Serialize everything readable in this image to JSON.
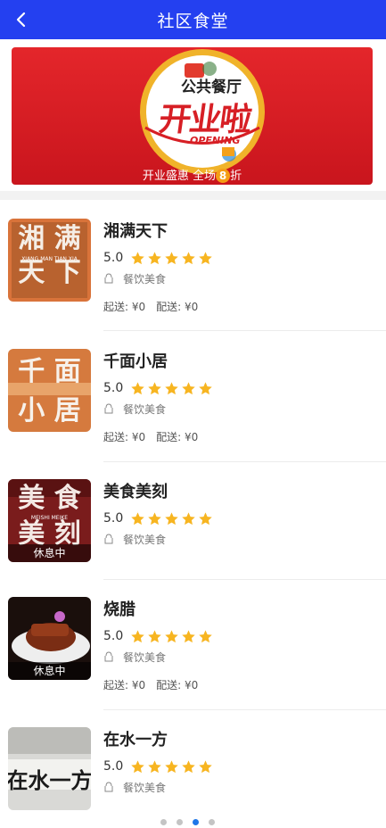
{
  "header": {
    "title": "社区食堂",
    "back_icon": "chevron-left-icon"
  },
  "banner": {
    "logo_text": "公共餐厅",
    "headline": "开业啦",
    "opening_text": "OPENING",
    "caption_pre": "开业盛惠  全场",
    "caption_num": "8",
    "caption_post": "折",
    "color": "#d71f25"
  },
  "restaurants": [
    {
      "name": "湘满天下",
      "score": "5.0",
      "stars": 5,
      "category": "餐饮美食",
      "min_order": "起送: ¥0",
      "delivery_fee": "配送: ¥0",
      "thumb_text": [
        "湘",
        "满",
        "天",
        "下"
      ],
      "thumb_subtitle": "XIANG MAN TIAN XIA",
      "resting": false
    },
    {
      "name": "千面小居",
      "score": "5.0",
      "stars": 5,
      "category": "餐饮美食",
      "min_order": "起送: ¥0",
      "delivery_fee": "配送: ¥0",
      "thumb_text": [
        "千",
        "面",
        "小",
        "居"
      ],
      "resting": false
    },
    {
      "name": "美食美刻",
      "score": "5.0",
      "stars": 5,
      "category": "餐饮美食",
      "thumb_text": [
        "美",
        "食",
        "美",
        "刻"
      ],
      "thumb_subtitle": "MEISHI MEIKE",
      "resting": true,
      "rest_label": "休息中"
    },
    {
      "name": "烧腊",
      "score": "5.0",
      "stars": 5,
      "category": "餐饮美食",
      "min_order": "起送: ¥0",
      "delivery_fee": "配送: ¥0",
      "resting": true,
      "rest_label": "休息中"
    },
    {
      "name": "在水一方",
      "score": "5.0",
      "stars": 5,
      "category": "餐饮美食",
      "thumb_sign": "在水一方",
      "resting": false
    }
  ],
  "pagination": {
    "count": 4,
    "active": 3
  },
  "colors": {
    "header": "#2440f0",
    "star": "#f7b521",
    "active_dot": "#1e77e8"
  }
}
